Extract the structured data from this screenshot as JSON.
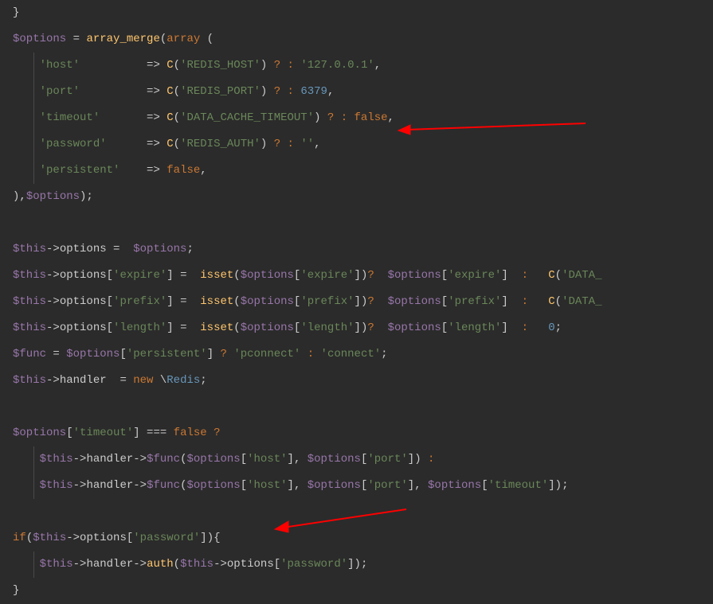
{
  "code": {
    "line1_brace": "}",
    "line2": {
      "var_options": "$options",
      "eq": " = ",
      "fn_array_merge": "array_merge",
      "lparen": "(",
      "kw_array": "array",
      "space_lparen": " ("
    },
    "line3": {
      "indent": "    ",
      "key": "'host'",
      "gap": "          ",
      "arrow": "=> ",
      "fn_c": "C",
      "lparen": "(",
      "arg": "'REDIS_HOST'",
      "rparen": ")",
      "ternary": " ? : ",
      "default": "'127.0.0.1'",
      "comma": ","
    },
    "line4": {
      "indent": "    ",
      "key": "'port'",
      "gap": "          ",
      "arrow": "=> ",
      "fn_c": "C",
      "lparen": "(",
      "arg": "'REDIS_PORT'",
      "rparen": ")",
      "ternary": " ? : ",
      "default": "6379",
      "comma": ","
    },
    "line5": {
      "indent": "    ",
      "key": "'timeout'",
      "gap": "       ",
      "arrow": "=> ",
      "fn_c": "C",
      "lparen": "(",
      "arg": "'DATA_CACHE_TIMEOUT'",
      "rparen": ")",
      "ternary": " ? : ",
      "default": "false",
      "comma": ","
    },
    "line6": {
      "indent": "    ",
      "key": "'password'",
      "gap": "      ",
      "arrow": "=> ",
      "fn_c": "C",
      "lparen": "(",
      "arg": "'REDIS_AUTH'",
      "rparen": ")",
      "ternary": " ? : ",
      "default": "''",
      "comma": ","
    },
    "line7": {
      "indent": "    ",
      "key": "'persistent'",
      "gap": "    ",
      "arrow": "=> ",
      "default": "false",
      "comma": ","
    },
    "line8": {
      "close": "),",
      "var": "$options",
      "end": ");"
    },
    "line10": {
      "this": "$this",
      "arrow": "->",
      "prop": "options",
      "eq": " =  ",
      "var": "$options",
      "semi": ";"
    },
    "line11": {
      "this": "$this",
      "arrow": "->",
      "prop": "options",
      "lbrack": "[",
      "key": "'expire'",
      "rbrack": "]",
      "eq": " =  ",
      "fn_isset": "isset",
      "lparen": "(",
      "var": "$options",
      "lbrack2": "[",
      "key2": "'expire'",
      "rbrack2": "]",
      "rparen": ")",
      "ternary": "?  ",
      "var2": "$options",
      "lbrack3": "[",
      "key3": "'expire'",
      "rbrack3": "]",
      "colon": "  :   ",
      "fn_c": "C",
      "lparen2": "(",
      "arg": "'DATA_"
    },
    "line12": {
      "this": "$this",
      "arrow": "->",
      "prop": "options",
      "lbrack": "[",
      "key": "'prefix'",
      "rbrack": "]",
      "eq": " =  ",
      "fn_isset": "isset",
      "lparen": "(",
      "var": "$options",
      "lbrack2": "[",
      "key2": "'prefix'",
      "rbrack2": "]",
      "rparen": ")",
      "ternary": "?  ",
      "var2": "$options",
      "lbrack3": "[",
      "key3": "'prefix'",
      "rbrack3": "]",
      "colon": "  :   ",
      "fn_c": "C",
      "lparen2": "(",
      "arg": "'DATA_"
    },
    "line13": {
      "this": "$this",
      "arrow": "->",
      "prop": "options",
      "lbrack": "[",
      "key": "'length'",
      "rbrack": "]",
      "eq": " =  ",
      "fn_isset": "isset",
      "lparen": "(",
      "var": "$options",
      "lbrack2": "[",
      "key2": "'length'",
      "rbrack2": "]",
      "rparen": ")",
      "ternary": "?  ",
      "var2": "$options",
      "lbrack3": "[",
      "key3": "'length'",
      "rbrack3": "]",
      "colon": "  :   ",
      "default": "0",
      "semi": ";"
    },
    "line14": {
      "var_func": "$func",
      "eq": " = ",
      "var": "$options",
      "lbrack": "[",
      "key": "'persistent'",
      "rbrack": "]",
      "ternary_q": " ? ",
      "val1": "'pconnect'",
      "ternary_c": " : ",
      "val2": "'connect'",
      "semi": ";"
    },
    "line15": {
      "this": "$this",
      "arrow": "->",
      "prop": "handler",
      "eq": "  = ",
      "kw_new": "new",
      "sp": " \\",
      "cls": "Redis",
      "semi": ";"
    },
    "line17": {
      "var": "$options",
      "lbrack": "[",
      "key": "'timeout'",
      "rbrack": "]",
      "op": " === ",
      "val": "false",
      "ternary": " ?"
    },
    "line18": {
      "indent": "    ",
      "this": "$this",
      "arrow": "->",
      "prop": "handler",
      "arrow2": "->",
      "var_func": "$func",
      "lparen": "(",
      "var": "$options",
      "lbrack": "[",
      "key": "'host'",
      "rbrack": "]",
      "comma": ", ",
      "var2": "$options",
      "lbrack2": "[",
      "key2": "'port'",
      "rbrack2": "]",
      "rparen": ")",
      "colon": " :"
    },
    "line19": {
      "indent": "    ",
      "this": "$this",
      "arrow": "->",
      "prop": "handler",
      "arrow2": "->",
      "var_func": "$func",
      "lparen": "(",
      "var": "$options",
      "lbrack": "[",
      "key": "'host'",
      "rbrack": "]",
      "comma": ", ",
      "var2": "$options",
      "lbrack2": "[",
      "key2": "'port'",
      "rbrack2": "]",
      "comma2": ", ",
      "var3": "$options",
      "lbrack3": "[",
      "key3": "'timeout'",
      "rbrack3": "]",
      "rparen": ")",
      "semi": ";"
    },
    "line21": {
      "kw_if": "if",
      "lparen": "(",
      "this": "$this",
      "arrow": "->",
      "prop": "options",
      "lbrack": "[",
      "key": "'password'",
      "rbrack": "]",
      "rparen": ")",
      "brace": "{"
    },
    "line22": {
      "indent": "    ",
      "this": "$this",
      "arrow": "->",
      "prop": "handler",
      "arrow2": "->",
      "fn": "auth",
      "lparen": "(",
      "this2": "$this",
      "arrow3": "->",
      "prop2": "options",
      "lbrack": "[",
      "key": "'password'",
      "rbrack": "]",
      "rparen": ")",
      "semi": ";"
    },
    "line23": {
      "brace": "}"
    }
  }
}
